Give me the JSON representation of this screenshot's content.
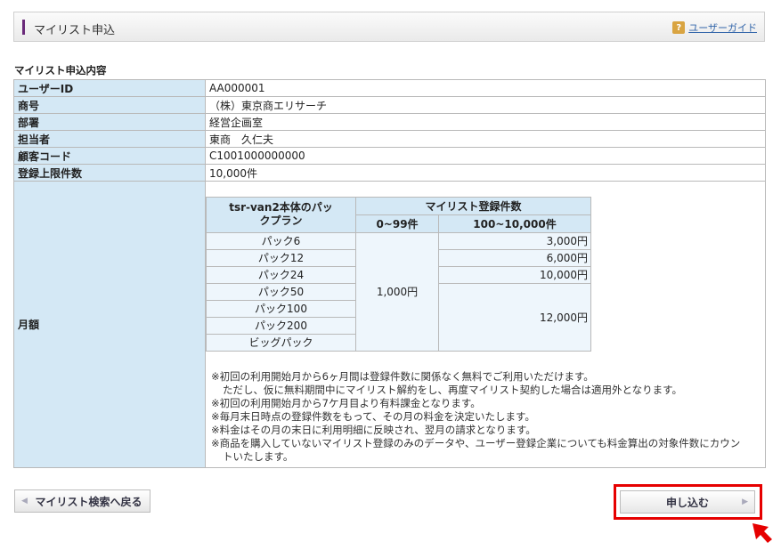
{
  "header": {
    "title": "マイリスト申込",
    "guide_icon": "?",
    "guide_link": "ユーザーガイド"
  },
  "section_title": "マイリスト申込内容",
  "rows": [
    {
      "label": "ユーザーID",
      "value": "AA000001"
    },
    {
      "label": "商号",
      "value": "（株）東京商エリサーチ"
    },
    {
      "label": "部署",
      "value": "経営企画室"
    },
    {
      "label": "担当者",
      "value": "東商　久仁夫"
    },
    {
      "label": "顧客コード",
      "value": "C1001000000000"
    },
    {
      "label": "登録上限件数",
      "value": "10,000件"
    }
  ],
  "monthly": {
    "label": "月額",
    "table": {
      "plan_header": "tsr-van2本体のパックプラン",
      "count_header": "マイリスト登録件数",
      "col1": "0~99件",
      "col2": "100~10,000件",
      "packs": [
        "パック6",
        "パック12",
        "パック24",
        "パック50",
        "パック100",
        "パック200",
        "ビッグパック"
      ],
      "price_low": "1,000円",
      "price_high": [
        "3,000円",
        "6,000円",
        "10,000円",
        "12,000円"
      ]
    },
    "notes": [
      "※初回の利用開始月から6ヶ月間は登録件数に関係なく無料でご利用いただけます。",
      "ただし、仮に無料期間中にマイリスト解約をし、再度マイリスト契約した場合は適用外となります。",
      "※初回の利用開始月から7ケ月目より有料課金となります。",
      "※毎月末日時点の登録件数をもって、その月の料金を決定いたします。",
      "※料金はその月の末日に利用明細に反映され、翌月の請求となります。",
      "※商品を購入していないマイリスト登録のみのデータや、ユーザー登録企業についても料金算出の対象件数にカウン",
      "トいたします。"
    ]
  },
  "buttons": {
    "back": "マイリスト検索へ戻る",
    "apply": "申し込む"
  },
  "colors": {
    "accent": "#6a2a7a",
    "header_cell": "#d4e8f5",
    "highlight": "#e60000"
  }
}
